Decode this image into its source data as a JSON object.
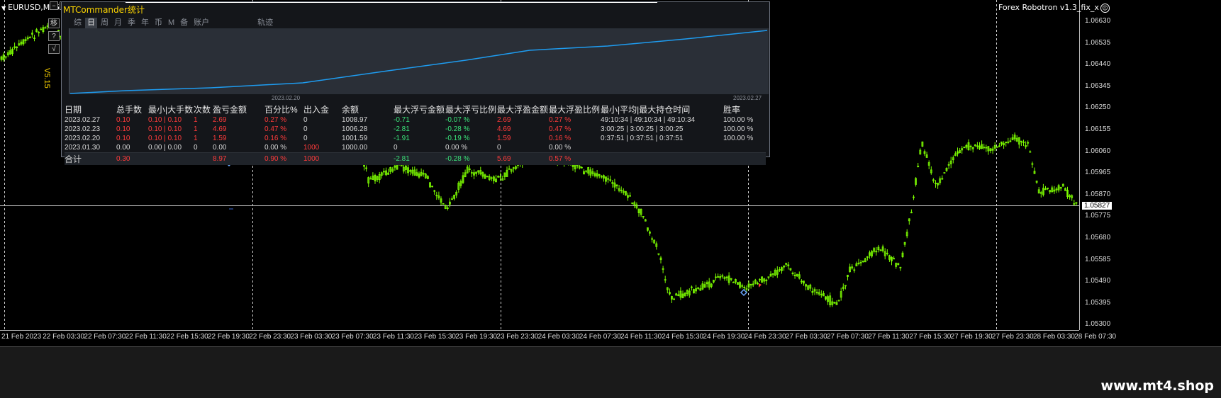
{
  "chart": {
    "symbol": "EURUSD,M15",
    "ea_name": "Forex Robotron v1.3_fix_x",
    "version_label": "V5.15",
    "side_tools": [
      "移",
      "?",
      "√"
    ],
    "window_buttons": [
      "−",
      "□"
    ],
    "current_price": "1.05827",
    "price_ticks": [
      "1.06630",
      "1.06535",
      "1.06440",
      "1.06345",
      "1.06250",
      "1.06155",
      "1.06060",
      "1.05965",
      "1.05870",
      "1.05775",
      "1.05680",
      "1.05585",
      "1.05490",
      "1.05395",
      "1.05300"
    ],
    "time_ticks": [
      "21 Feb 2023",
      "22 Feb 03:30",
      "22 Feb 07:30",
      "22 Feb 11:30",
      "22 Feb 15:30",
      "22 Feb 19:30",
      "22 Feb 23:30",
      "23 Feb 03:30",
      "23 Feb 07:30",
      "23 Feb 11:30",
      "23 Feb 15:30",
      "23 Feb 19:30",
      "23 Feb 23:30",
      "24 Feb 03:30",
      "24 Feb 07:30",
      "24 Feb 11:30",
      "24 Feb 15:30",
      "24 Feb 19:30",
      "24 Feb 23:30",
      "27 Feb 03:30",
      "27 Feb 07:30",
      "27 Feb 11:30",
      "27 Feb 15:30",
      "27 Feb 19:30",
      "27 Feb 23:30",
      "28 Feb 03:30",
      "28 Feb 07:30"
    ],
    "watermark": "www.mt4.shop",
    "candle_color": "#7CFC00",
    "price_line_color": "#bfbfbf"
  },
  "panel": {
    "title": "MTCommander统计",
    "tabs": [
      "综",
      "日",
      "周",
      "月",
      "季",
      "年",
      "币",
      "M",
      "备",
      "账户",
      "轨迹"
    ],
    "active_tab": "日",
    "equity_dates": [
      "2023.02.20",
      "2023.02.27"
    ],
    "equity_line_color": "#1e9cf0",
    "columns": [
      "日期",
      "总手数",
      "最小|大手数",
      "次数",
      "盈亏金额",
      "百分比%",
      "出入金",
      "余额",
      "最大浮亏金额",
      "最大浮亏比例",
      "最大浮盈金额",
      "最大浮盈比例",
      "最小|平均|最大持仓时间",
      "胜率"
    ],
    "rows": [
      [
        "2023.02.27",
        "0.10",
        "0.10 | 0.10",
        "1",
        "2.69",
        "0.27 %",
        "0",
        "1008.97",
        "-0.71",
        "-0.07 %",
        "2.69",
        "0.27 %",
        "49:10:34 | 49:10:34 | 49:10:34",
        "100.00 %"
      ],
      [
        "2023.02.23",
        "0.10",
        "0.10 | 0.10",
        "1",
        "4.69",
        "0.47 %",
        "0",
        "1006.28",
        "-2.81",
        "-0.28 %",
        "4.69",
        "0.47 %",
        "3:00:25 | 3:00:25 | 3:00:25",
        "100.00 %"
      ],
      [
        "2023.02.20",
        "0.10",
        "0.10 | 0.10",
        "1",
        "1.59",
        "0.16 %",
        "0",
        "1001.59",
        "-1.91",
        "-0.19 %",
        "1.59",
        "0.16 %",
        "0:37:51 | 0:37:51 | 0:37:51",
        "100.00 %"
      ],
      [
        "2023.01.30",
        "0.00",
        "0.00 | 0.00",
        "0",
        "0.00",
        "0.00 %",
        "1000",
        "1000.00",
        "0",
        "0.00 %",
        "0",
        "0.00 %",
        "",
        ""
      ]
    ],
    "total_row": [
      "合计",
      "0.30",
      "",
      "",
      "8.97",
      "0.90 %",
      "1000",
      "",
      "-2.81",
      "-0.28 %",
      "5.69",
      "0.57 %",
      "",
      ""
    ]
  }
}
